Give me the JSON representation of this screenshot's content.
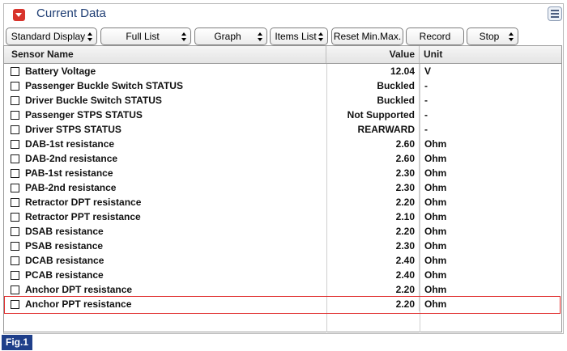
{
  "window": {
    "title": "Current Data"
  },
  "toolbar": {
    "buttons": [
      {
        "label": "Standard Display",
        "has_spinner": true
      },
      {
        "label": "Full List",
        "has_spinner": true
      },
      {
        "label": "Graph",
        "has_spinner": true
      },
      {
        "label": "Items List",
        "has_spinner": true
      },
      {
        "label": "Reset Min.Max.",
        "has_spinner": false
      },
      {
        "label": "Record",
        "has_spinner": false
      },
      {
        "label": "Stop",
        "has_spinner": true
      }
    ]
  },
  "table": {
    "columns": {
      "name": "Sensor Name",
      "value": "Value",
      "unit": "Unit"
    },
    "rows": [
      {
        "name": "Battery Voltage",
        "value": "12.04",
        "unit": "V"
      },
      {
        "name": "Passenger Buckle Switch STATUS",
        "value": "Buckled",
        "unit": "-"
      },
      {
        "name": "Driver Buckle Switch STATUS",
        "value": "Buckled",
        "unit": "-"
      },
      {
        "name": "Passenger STPS STATUS",
        "value": "Not Supported",
        "unit": "-"
      },
      {
        "name": "Driver STPS STATUS",
        "value": "REARWARD",
        "unit": "-"
      },
      {
        "name": "DAB-1st resistance",
        "value": "2.60",
        "unit": "Ohm"
      },
      {
        "name": "DAB-2nd resistance",
        "value": "2.60",
        "unit": "Ohm"
      },
      {
        "name": "PAB-1st resistance",
        "value": "2.30",
        "unit": "Ohm"
      },
      {
        "name": "PAB-2nd resistance",
        "value": "2.30",
        "unit": "Ohm"
      },
      {
        "name": "Retractor DPT resistance",
        "value": "2.20",
        "unit": "Ohm"
      },
      {
        "name": "Retractor PPT resistance",
        "value": "2.10",
        "unit": "Ohm"
      },
      {
        "name": "DSAB resistance",
        "value": "2.20",
        "unit": "Ohm"
      },
      {
        "name": "PSAB resistance",
        "value": "2.30",
        "unit": "Ohm"
      },
      {
        "name": "DCAB resistance",
        "value": "2.40",
        "unit": "Ohm"
      },
      {
        "name": "PCAB resistance",
        "value": "2.40",
        "unit": "Ohm"
      },
      {
        "name": "Anchor DPT resistance",
        "value": "2.20",
        "unit": "Ohm"
      },
      {
        "name": "Anchor PPT resistance",
        "value": "2.20",
        "unit": "Ohm",
        "highlighted": true
      }
    ]
  },
  "figure_label": "Fig.1",
  "colors": {
    "title": "#1f3e74",
    "collapse_button": "#d8342c",
    "highlight_border": "#e02c2c",
    "figure_label_bg": "#1f3f8a"
  },
  "icons": {
    "collapse": "chevron-down-icon",
    "menu": "menu-icon"
  }
}
